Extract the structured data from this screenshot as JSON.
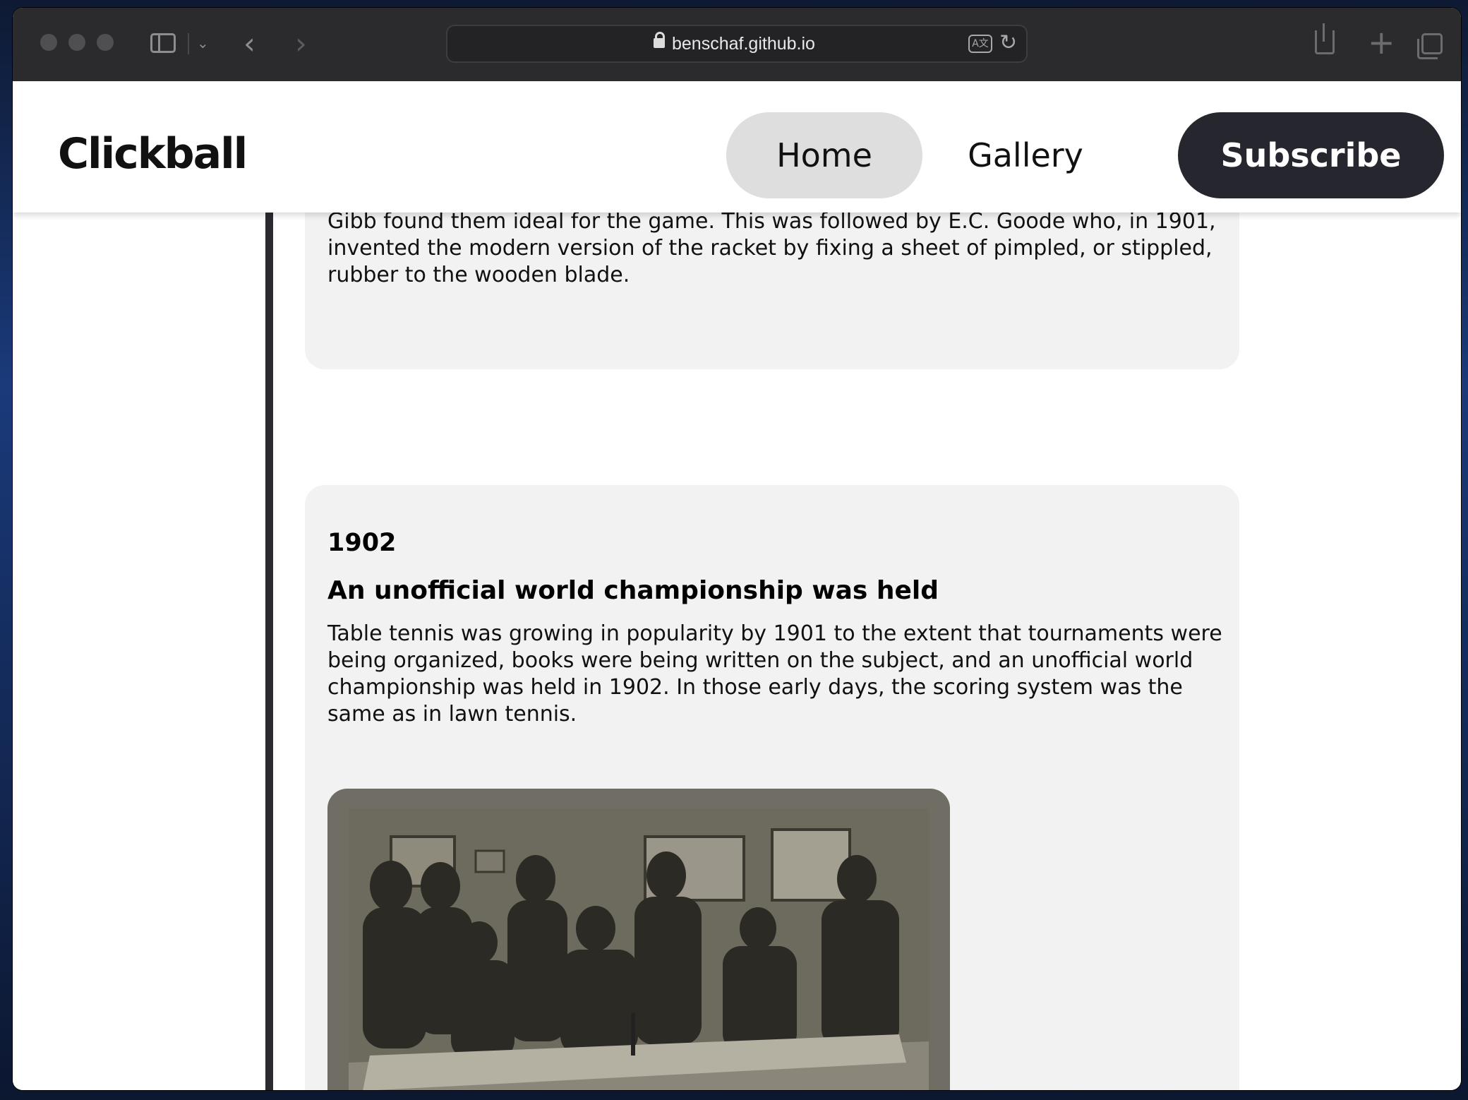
{
  "browser": {
    "url": "benschaf.github.io"
  },
  "site": {
    "logo": "Clickball",
    "nav": {
      "home": "Home",
      "gallery": "Gallery",
      "subscribe": "Subscribe"
    }
  },
  "timeline": {
    "cards": [
      {
        "text": "Gibb found them ideal for the game. This was followed by E.C. Goode who, in 1901, invented the modern version of the racket by fixing a sheet of pimpled, or stippled, rubber to the wooden blade."
      },
      {
        "year": "1902",
        "title": "An unofficial world championship was held",
        "text": "Table tennis was growing in popularity by 1901 to the extent that tournaments were being organized, books were being written on the subject, and an unofficial world championship was held in 1902. In those early days, the scoring system was the same as in lawn tennis.",
        "image": "sepia photograph of men gathered around a table tennis table"
      }
    ]
  },
  "colors": {
    "header_bg": "#ffffff",
    "home_pill": "#dedede",
    "subscribe_pill": "#26262e",
    "card_bg": "#f2f2f2",
    "timeline_line": "#2a2a30"
  },
  "icons": [
    "lock-icon",
    "translate-icon",
    "reload-icon",
    "back-icon",
    "forward-icon",
    "sidebar-icon",
    "share-icon",
    "new-tab-icon",
    "tabs-overview-icon"
  ]
}
